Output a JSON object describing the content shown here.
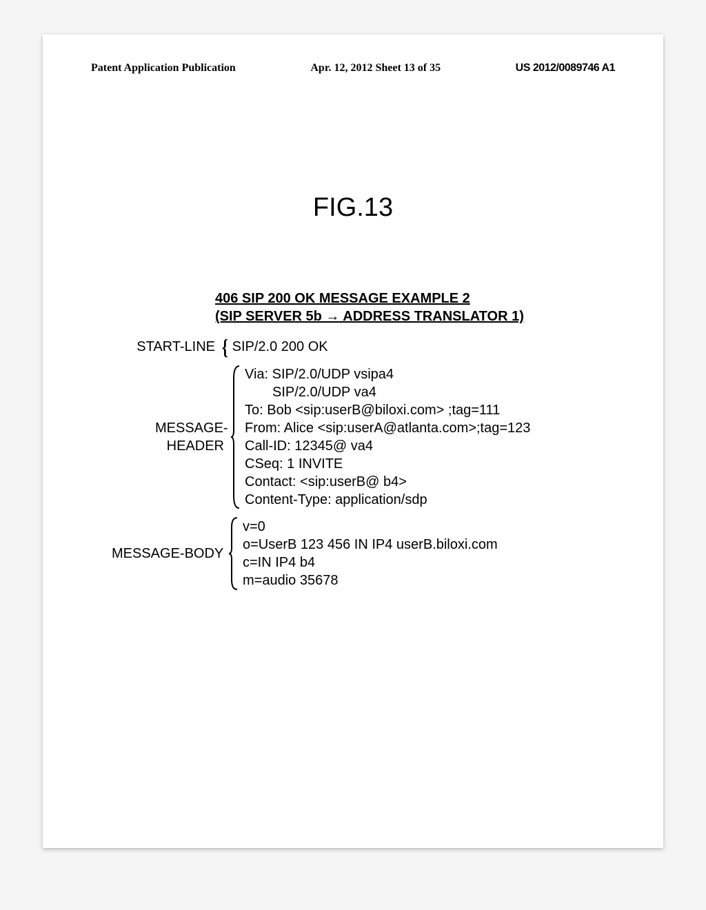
{
  "header": {
    "left": "Patent Application Publication",
    "middle": "Apr. 12, 2012  Sheet 13 of 35",
    "right": "US 2012/0089746 A1"
  },
  "figure_label": "FIG.13",
  "message": {
    "title_line1": "406 SIP 200 OK MESSAGE EXAMPLE 2",
    "title_line2": "(SIP SERVER 5b → ADDRESS TRANSLATOR 1)",
    "start_line": {
      "label": "START-LINE",
      "value": "SIP/2.0 200 OK"
    },
    "header_block": {
      "label": "MESSAGE-\nHEADER",
      "lines": [
        "Via: SIP/2.0/UDP vsipa4",
        "SIP/2.0/UDP va4",
        "To: Bob <sip:userB@biloxi.com> ;tag=111",
        "From: Alice <sip:userA@atlanta.com>;tag=123",
        "Call-ID: 12345@ va4",
        "CSeq: 1 INVITE",
        "Contact: <sip:userB@ b4>",
        "Content-Type: application/sdp"
      ]
    },
    "body_block": {
      "label": "MESSAGE-BODY",
      "lines": [
        "v=0",
        "o=UserB 123 456 IN IP4 userB.biloxi.com",
        "c=IN IP4 b4",
        "m=audio 35678"
      ]
    }
  }
}
